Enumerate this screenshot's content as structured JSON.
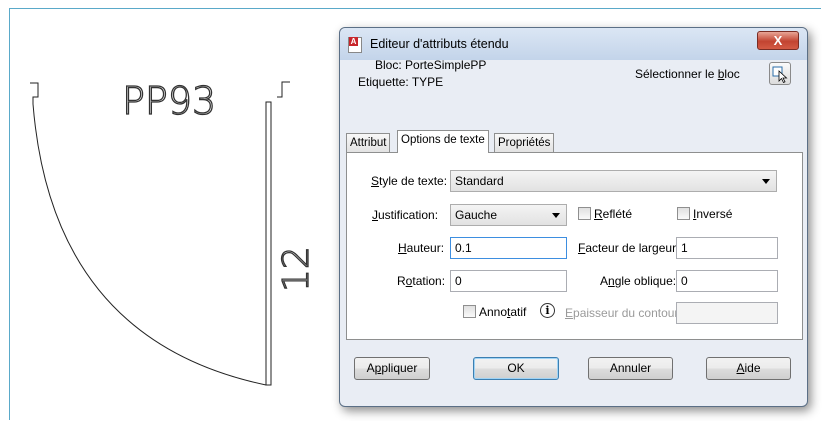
{
  "drawing": {
    "label_top": "PP93",
    "label_side": "12"
  },
  "dialog": {
    "title": "Editeur d'attributs étendu",
    "close_label": "X",
    "bloc_label": "Bloc: PorteSimplePP",
    "etiquette_label": "Etiquette: TYPE",
    "select_block_label": "Sélectionner le bloc",
    "tabs": [
      {
        "label": "Attribut"
      },
      {
        "label": "Options de texte",
        "active": true
      },
      {
        "label": "Propriétés"
      }
    ],
    "options": {
      "style_label": "Style de texte:",
      "style_value": "Standard",
      "justification_label": "Justification:",
      "justification_value": "Gauche",
      "reflete_label": "Reflété",
      "reflete_checked": false,
      "inverse_label": "Inversé",
      "inverse_checked": false,
      "hauteur_label": "Hauteur:",
      "hauteur_value": "0.1",
      "facteur_label": "Facteur de largeur:",
      "facteur_value": "1",
      "rotation_label": "Rotation:",
      "rotation_value": "0",
      "angle_label": "Angle oblique:",
      "angle_value": "0",
      "annotatif_label": "Annotatif",
      "annotatif_checked": false,
      "info_icon": "info-icon",
      "epaisseur_label": "Epaisseur du contour:",
      "epaisseur_value": ""
    },
    "buttons": {
      "apply": "Appliquer",
      "ok": "OK",
      "cancel": "Annuler",
      "help": "Aide"
    }
  },
  "colors": {
    "frame_accent": "#5aa9c9",
    "titlebar": "#c3d4ea",
    "close": "#c24431"
  }
}
